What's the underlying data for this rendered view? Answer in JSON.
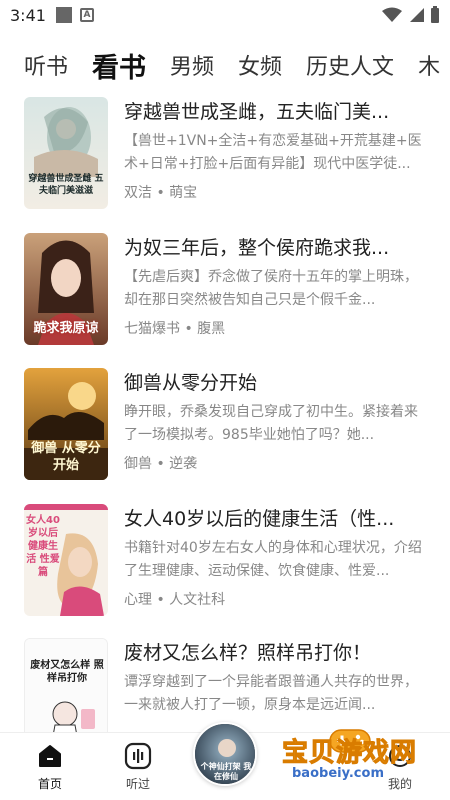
{
  "status_bar": {
    "time": "3:41",
    "a_glyph": "A"
  },
  "tabs": [
    {
      "label": "听书",
      "active": false
    },
    {
      "label": "看书",
      "active": true
    },
    {
      "label": "男频",
      "active": false
    },
    {
      "label": "女频",
      "active": false
    },
    {
      "label": "历史人文",
      "active": false
    },
    {
      "label": "木",
      "active": false
    }
  ],
  "books": [
    {
      "title": "穿越兽世成圣雌，五夫临门美...",
      "desc": "【兽世+1VN+全洁+有恋爱基础+开荒基建+医术+日常+打脸+后面有异能】现代中医学徒...",
      "meta": "双洁 • 萌宝",
      "cover_text": "穿越兽世成圣雌 五夫临门美滋滋"
    },
    {
      "title": "为奴三年后，整个侯府跪求我...",
      "desc": "【先虐后爽】乔念做了侯府十五年的掌上明珠，却在那日突然被告知自己只是个假千金...",
      "meta": "七猫爆书 • 腹黑",
      "cover_text": "跪求我原谅"
    },
    {
      "title": "御兽从零分开始",
      "desc": "睁开眼，乔桑发现自己穿成了初中生。紧接着来了一场模拟考。985毕业她怕了吗？她...",
      "meta": "御兽 • 逆袭",
      "cover_text": "御兽 从零分开始"
    },
    {
      "title": "女人40岁以后的健康生活（性...",
      "desc": "书籍针对40岁左右女人的身体和心理状况，介绍了生理健康、运动保健、饮食健康、性爱...",
      "meta": "心理 • 人文社科",
      "cover_text": "女人40岁以后 健康生活 性爱篇"
    },
    {
      "title": "废材又怎么样？照样吊打你！",
      "desc": "谭浮穿越到了一个异能者跟普通人共存的世界，一来就被人打了一顿，原身本是远近闻...",
      "meta": "",
      "cover_text": "废材又怎么样 照样吊打你"
    }
  ],
  "bottom_nav": {
    "home": "首页",
    "listened": "听过",
    "mine": "我的"
  },
  "center_disc_text": "个神仙打架 我在修仙",
  "watermark": {
    "text": "宝贝游戏网",
    "url": "baobeiy.com"
  },
  "colors": {
    "accent_orange": "#f5a623",
    "text_gray": "#888888",
    "title_dark": "#222222"
  }
}
